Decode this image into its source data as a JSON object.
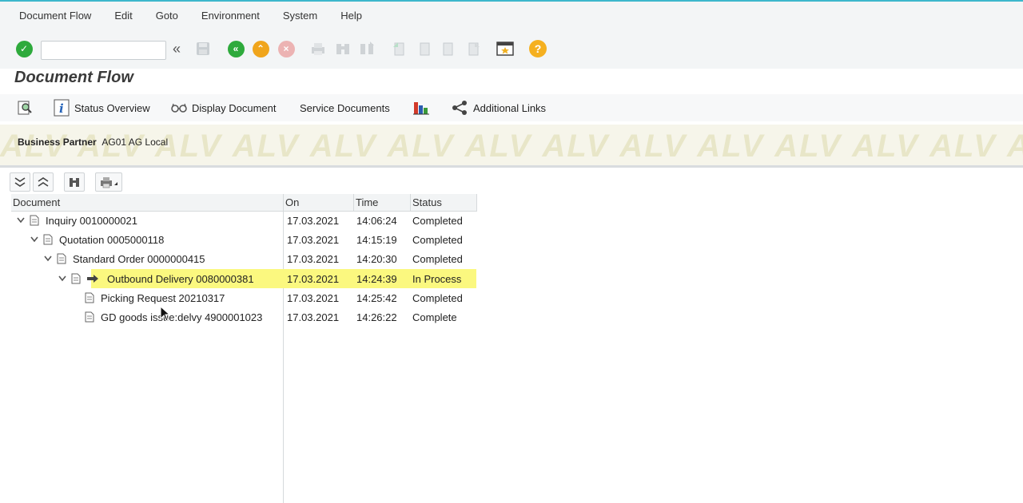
{
  "menu": [
    "Document Flow",
    "Edit",
    "Goto",
    "Environment",
    "System",
    "Help"
  ],
  "toolbar": {
    "command_field": "",
    "icons": [
      "enter-icon",
      "back-double-icon",
      "save-icon",
      "back-icon",
      "exit-icon",
      "cancel-icon",
      "print-icon",
      "find-icon",
      "find-next-icon",
      "first-page-icon",
      "prev-page-icon",
      "next-page-icon",
      "last-page-icon",
      "layout-icon",
      "help-icon"
    ],
    "colors": {
      "enter": "#2eaa3c",
      "back": "#2eaa3c",
      "exit": "#f0a51c",
      "cancel": "#e06060",
      "help": "#f5b020"
    }
  },
  "page": {
    "title": "Document Flow"
  },
  "app_toolbar": {
    "status_overview": "Status Overview",
    "display_document": "Display Document",
    "service_documents": "Service Documents",
    "additional_links": "Additional Links"
  },
  "header": {
    "bp_label": "Business Partner",
    "bp_value": "AG01 AG Local",
    "watermark": "ALV"
  },
  "table": {
    "columns": [
      "Document",
      "On",
      "Time",
      "Status"
    ],
    "rows": [
      {
        "document": "Inquiry 0010000021",
        "on": "17.03.2021",
        "time": "14:06:24",
        "status": "Completed"
      },
      {
        "document": "Quotation 0005000118",
        "on": "17.03.2021",
        "time": "14:15:19",
        "status": "Completed"
      },
      {
        "document": "Standard Order 0000000415",
        "on": "17.03.2021",
        "time": "14:20:30",
        "status": "Completed"
      },
      {
        "document": "Outbound Delivery 0080000381",
        "on": "17.03.2021",
        "time": "14:24:39",
        "status": "In Process"
      },
      {
        "document": "Picking Request 20210317",
        "on": "17.03.2021",
        "time": "14:25:42",
        "status": "Completed"
      },
      {
        "document": "GD goods issue:delvy 4900001023",
        "on": "17.03.2021",
        "time": "14:26:22",
        "status": "Complete"
      }
    ],
    "highlight_color": "#fbf87f"
  }
}
